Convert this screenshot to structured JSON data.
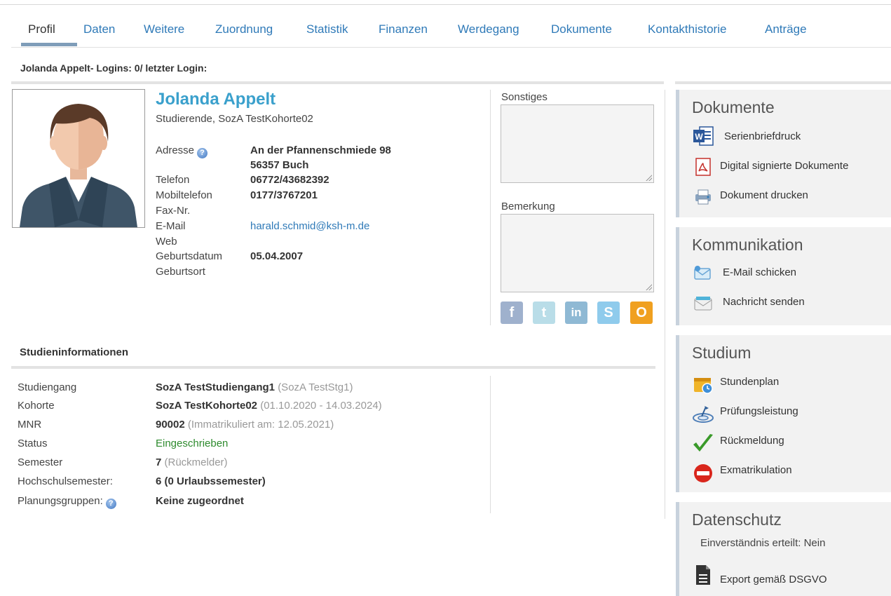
{
  "tabs": [
    "Profil",
    "Daten",
    "Weitere",
    "Zuordnung",
    "Statistik",
    "Finanzen",
    "Werdegang",
    "Dokumente",
    "Kontakthistorie",
    "Anträge"
  ],
  "login_line": "Jolanda Appelt- Logins: 0/ letzter Login:",
  "profile": {
    "name": "Jolanda Appelt",
    "subtitle": "Studierende, SozA TestKohorte02",
    "labels": {
      "address": "Adresse",
      "phone": "Telefon",
      "mobile": "Mobiltelefon",
      "fax": "Fax-Nr.",
      "email": "E-Mail",
      "web": "Web",
      "birthdate": "Geburtsdatum",
      "birthplace": "Geburtsort"
    },
    "address_line1": "An der Pfannenschmiede 98",
    "address_line2": "56357 Buch",
    "phone": "06772/43682392",
    "mobile": "0177/3767201",
    "email": "harald.schmid@ksh-m.de",
    "birthdate": "05.04.2007"
  },
  "notes": {
    "misc_label": "Sonstiges",
    "remark_label": "Bemerkung"
  },
  "social": [
    "facebook-icon",
    "twitter-icon",
    "linkedin-icon",
    "skype-icon",
    "xing-icon"
  ],
  "study": {
    "title": "Studieninformationen",
    "rows": [
      {
        "label": "Studiengang",
        "value": "SozA TestStudiengang1",
        "extra": "(SozA TestStg1)"
      },
      {
        "label": "Kohorte",
        "value": "SozA TestKohorte02",
        "extra": "(01.10.2020 - 14.03.2024)"
      },
      {
        "label": "MNR",
        "value": "90002",
        "extra": "(Immatrikuliert am: 12.05.2021)"
      },
      {
        "label": "Status",
        "value": "Eingeschrieben",
        "extra": ""
      },
      {
        "label": "Semester",
        "value": "7",
        "extra": "(Rückmelder)"
      },
      {
        "label": "Hochschulsemester:",
        "value": "6 (0 Urlaubssemester)",
        "extra": ""
      },
      {
        "label": "Planungsgruppen:",
        "value": "Keine zugeordnet",
        "extra": ""
      }
    ]
  },
  "panels": {
    "documents": {
      "title": "Dokumente",
      "items": [
        "Serienbriefdruck",
        "Digital signierte Dokumente",
        "Dokument drucken"
      ]
    },
    "communication": {
      "title": "Kommunikation",
      "items": [
        "E-Mail schicken",
        "Nachricht senden"
      ]
    },
    "studium": {
      "title": "Studium",
      "items": [
        "Stundenplan",
        "Prüfungsleistung",
        "Rückmeldung",
        "Exmatrikulation"
      ]
    },
    "privacy": {
      "title": "Datenschutz",
      "consent": "Einverständnis erteilt: Nein",
      "export": "Export gemäß DSGVO"
    }
  },
  "colors": {
    "link": "#2f7ab8",
    "name": "#3aa0cc",
    "status_green": "#2e8b2e",
    "panel_bg": "#f2f2f2"
  }
}
